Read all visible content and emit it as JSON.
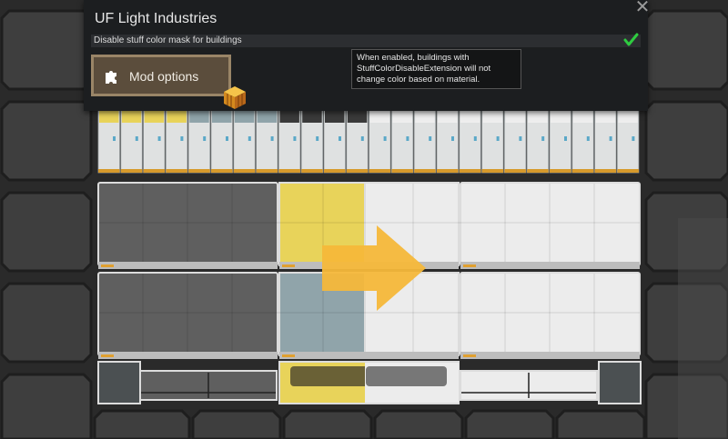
{
  "dialog": {
    "title": "UF Light Industries",
    "close_icon": "close-x-icon"
  },
  "setting": {
    "label": "Disable stuff color mask for buildings",
    "checked": true,
    "check_color": "#2ecc40"
  },
  "mod_options": {
    "label": "Mod options",
    "icon": "puzzle-piece-icon",
    "accent_icon": "crate-icon"
  },
  "tooltip": {
    "lines": [
      "When enabled, buildings with",
      "StuffColorDisableExtension will not",
      "change color based on material."
    ]
  },
  "preview": {
    "arrow_color": "#f6b83a",
    "material_colors": {
      "gold": "#e8d35a",
      "steel": "#5f5f5f",
      "jade": "#90a4aa",
      "white": "#ececec"
    }
  }
}
